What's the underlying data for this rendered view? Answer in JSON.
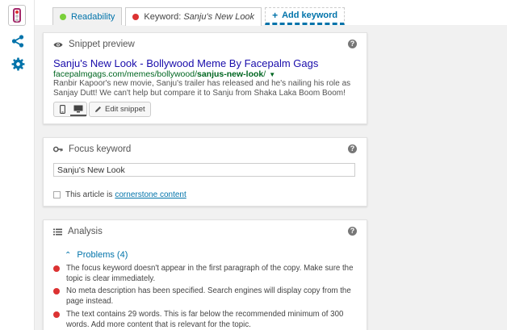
{
  "colors": {
    "bad": "#dc3232",
    "good": "#7ad03a",
    "link": "#0073aa",
    "brand": "#a4286a"
  },
  "sidebar": {
    "items": [
      {
        "name": "traffic-light-icon"
      },
      {
        "name": "share-icon"
      },
      {
        "name": "gear-icon"
      }
    ]
  },
  "tabs": {
    "readability": "Readability",
    "keyword_prefix": "Keyword:",
    "keyword_value": "Sanju's New Look",
    "add": "Add keyword"
  },
  "snippet": {
    "title": "Snippet preview",
    "seo_title": "Sanju's New Look - Bollywood Meme By Facepalm Gags",
    "url_base": "facepalmgags.com/memes/bollywood/",
    "url_slug": "sanjus-new-look",
    "url_end": "/",
    "description": "Ranbir Kapoor's new movie, Sanju's trailer has released and he's nailing his role as Sanjay Dutt! We can't help but compare it to Sanju from Shaka Laka Boom Boom!",
    "edit_label": "Edit snippet"
  },
  "focus": {
    "title": "Focus keyword",
    "value": "Sanju's New Look",
    "cornerstone_prefix": "This article is",
    "cornerstone_link": "cornerstone content"
  },
  "analysis": {
    "title": "Analysis",
    "problems_label": "Problems (4)",
    "results": [
      "The focus keyword doesn't appear in the first paragraph of the copy. Make sure the topic is clear immediately.",
      "No meta description has been specified. Search engines will display copy from the page instead.",
      "The text contains 29 words. This is far below the recommended minimum of 300 words. Add more content that is relevant for the topic."
    ]
  }
}
